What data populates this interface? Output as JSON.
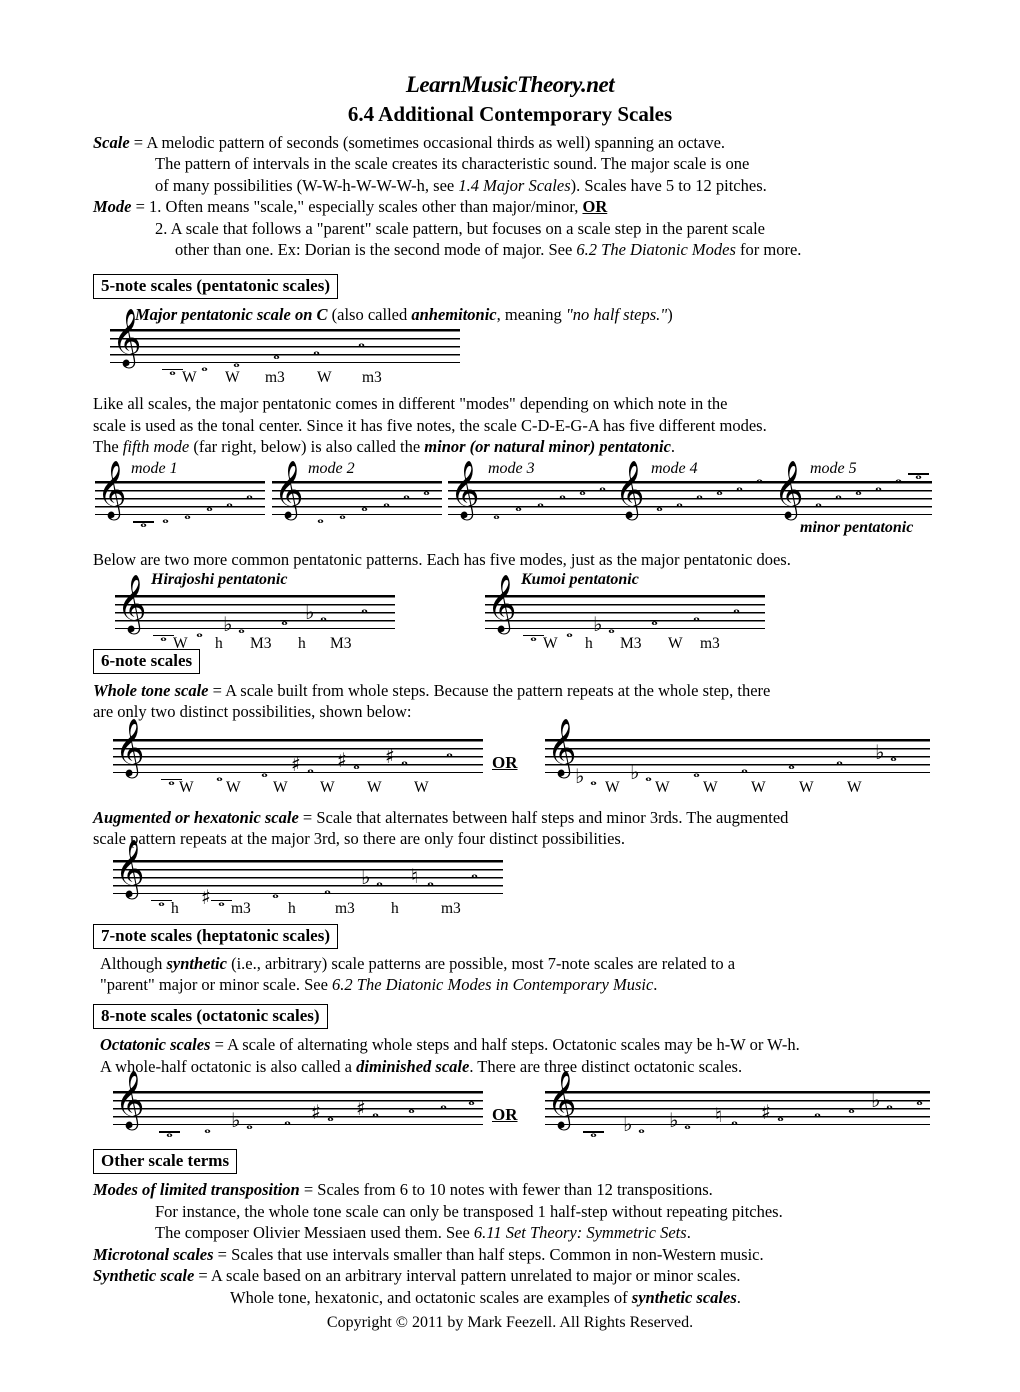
{
  "header": {
    "logo": "LearnMusicTheory.net",
    "title": "6.4 Additional Contemporary Scales"
  },
  "intro": {
    "scale_term": "Scale",
    "scale_def": " = A melodic pattern of seconds (sometimes occasional thirds as well) spanning an octave.",
    "scale_line2a": "The pattern of intervals in the scale creates its characteristic sound. The major scale is one",
    "scale_line3a": "of many possibilities (W-W-h-W-W-W-h, see ",
    "scale_line3_ital": "1.4 Major Scales",
    "scale_line3b": "). Scales have 5 to 12 pitches.",
    "mode_term": "Mode",
    "mode_def1a": " = 1. Often means \"scale,\" especially scales other than major/minor, ",
    "mode_or": "OR",
    "mode_def2": "2. A scale that follows a \"parent\" scale pattern, but focuses on a scale step in the parent scale",
    "mode_def3a": "other than one. Ex: Dorian is the second mode of major. See ",
    "mode_def3_ital": "6.2 The Diatonic Modes",
    "mode_def3b": " for more."
  },
  "sections": {
    "five_note": "5-note scales (pentatonic scales)",
    "six_note": "6-note scales",
    "seven_note": "7-note scales (heptatonic scales)",
    "eight_note": "8-note scales (octatonic scales)",
    "other_terms": "Other scale terms"
  },
  "pentatonic": {
    "caption_bold": "Major pentatonic scale on C",
    "caption_mid": " (also called ",
    "caption_bold2": "anhemitonic",
    "caption_mid2": ", meaning ",
    "caption_ital": "\"no half steps.\"",
    "caption_end": ")",
    "para_l1": "Like all scales, the major pentatonic comes in different \"modes\" depending on which note in the",
    "para_l2": "scale is used as the tonal center. Since it has five notes, the scale C-D-E-G-A has five different modes.",
    "para_l3a": "The ",
    "para_l3_ital": "fifth mode",
    "para_l3b": " (far right, below) is also called the ",
    "para_l3_bold": "minor (or natural minor) pentatonic",
    "para_l3c": ".",
    "modes_labels": [
      "mode 1",
      "mode 2",
      "mode 3",
      "mode 4",
      "mode 5"
    ],
    "minor_pent_label": "minor pentatonic",
    "below_text": "Below are two more common pentatonic patterns. Each has five modes, just as the major pentatonic does.",
    "hirajoshi_label": "Hirajoshi pentatonic",
    "kumoi_label": "Kumoi pentatonic"
  },
  "whole_tone": {
    "term": "Whole tone scale",
    "def_l1": " = A scale built from whole steps. Because the pattern repeats at the whole step, there",
    "def_l2": "are only two distinct possibilities, shown below:",
    "or_label": "OR"
  },
  "augmented": {
    "term": "Augmented or hexatonic scale",
    "def_l1": " = Scale that alternates between half steps and minor 3rds. The augmented",
    "def_l2": "scale pattern repeats at the major 3rd, so there are only four distinct possibilities."
  },
  "heptatonic": {
    "l1a": "Although ",
    "l1_bold": "synthetic",
    "l1b": " (i.e., arbitrary) scale patterns are possible, most 7-note scales are related to a",
    "l2a": "\"parent\" major or minor scale. See ",
    "l2_ital": "6.2 The Diatonic Modes in Contemporary Music",
    "l2b": "."
  },
  "octatonic": {
    "term": "Octatonic scales",
    "def_l1": " = A scale of alternating whole steps and half steps. Octatonic scales may be h-W or W-h.",
    "def_l2a": "A whole-half octatonic is also called a ",
    "def_l2_bold": "diminished scale",
    "def_l2b": ". There are three distinct octatonic scales.",
    "or_label": "OR"
  },
  "other_terms": {
    "mlt_term": "Modes of limited transposition",
    "mlt_def": " = Scales from 6 to 10 notes with fewer than 12 transpositions.",
    "mlt_l2": "For instance, the whole tone scale can only be transposed 1 half-step without repeating pitches.",
    "mlt_l3a": "The composer Olivier Messiaen used them. See ",
    "mlt_l3_ital": "6.11 Set Theory: Symmetric Sets",
    "mlt_l3b": ".",
    "micro_term": "Microtonal scales",
    "micro_def": " = Scales that use intervals smaller than half steps. Common in non-Western music.",
    "synth_term": "Synthetic scale",
    "synth_def": " = A scale based on an arbitrary interval pattern unrelated to major or minor scales.",
    "synth_l2a": "Whole tone, hexatonic, and octatonic scales are examples of ",
    "synth_l2_bold": "synthetic scales",
    "synth_l2b": "."
  },
  "copyright": "Copyright © 2011 by Mark Feezell. All Rights Reserved.",
  "chart_data": {
    "type": "table",
    "title": "Contemporary scale notation examples",
    "staves": [
      {
        "name": "major-pentatonic-on-C",
        "clef": "treble",
        "notes": [
          "C4",
          "D4",
          "E4",
          "G4",
          "A4",
          "C5"
        ],
        "accidentals": [
          "",
          "",
          "",
          "",
          "",
          ""
        ],
        "intervals": [
          "W",
          "W",
          "m3",
          "W",
          "m3"
        ]
      },
      {
        "name": "pentatonic-mode-1",
        "clef": "treble",
        "notes": [
          "C4",
          "D4",
          "E4",
          "G4",
          "A4",
          "C5"
        ],
        "intervals": []
      },
      {
        "name": "pentatonic-mode-2",
        "clef": "treble",
        "notes": [
          "D4",
          "E4",
          "G4",
          "A4",
          "C5",
          "D5"
        ],
        "intervals": []
      },
      {
        "name": "pentatonic-mode-3",
        "clef": "treble",
        "notes": [
          "E4",
          "G4",
          "A4",
          "C5",
          "D5",
          "E5"
        ],
        "intervals": []
      },
      {
        "name": "pentatonic-mode-4",
        "clef": "treble",
        "notes": [
          "G4",
          "A4",
          "C5",
          "D5",
          "E5",
          "G5"
        ],
        "intervals": []
      },
      {
        "name": "pentatonic-mode-5",
        "clef": "treble",
        "notes": [
          "A4",
          "C5",
          "D5",
          "E5",
          "G5",
          "A5"
        ],
        "intervals": []
      },
      {
        "name": "hirajoshi-pentatonic",
        "clef": "treble",
        "notes": [
          "C4",
          "D4",
          "Eb4",
          "G4",
          "Ab4",
          "C5"
        ],
        "accidentals": [
          "",
          "",
          "flat",
          "",
          "flat",
          ""
        ],
        "intervals": [
          "W",
          "h",
          "M3",
          "h",
          "M3"
        ]
      },
      {
        "name": "kumoi-pentatonic",
        "clef": "treble",
        "notes": [
          "C4",
          "D4",
          "Eb4",
          "G4",
          "A4",
          "C5"
        ],
        "accidentals": [
          "",
          "",
          "flat",
          "",
          "",
          ""
        ],
        "intervals": [
          "W",
          "h",
          "M3",
          "W",
          "m3"
        ]
      },
      {
        "name": "whole-tone-scale-1",
        "clef": "treble",
        "notes": [
          "C4",
          "D4",
          "E4",
          "F#4",
          "G#4",
          "A#4",
          "C5"
        ],
        "accidentals": [
          "",
          "",
          "",
          "sharp",
          "sharp",
          "sharp",
          ""
        ],
        "intervals": [
          "W",
          "W",
          "W",
          "W",
          "W",
          "W"
        ]
      },
      {
        "name": "whole-tone-scale-2",
        "clef": "treble",
        "notes": [
          "Db4",
          "Eb4",
          "F4",
          "G4",
          "A4",
          "B4",
          "Db5"
        ],
        "accidentals": [
          "flat",
          "flat",
          "",
          "",
          "",
          "",
          "flat"
        ],
        "intervals": [
          "W",
          "W",
          "W",
          "W",
          "W",
          "W"
        ]
      },
      {
        "name": "augmented-hexatonic-scale",
        "clef": "treble",
        "notes": [
          "C4",
          "C#4",
          "E4",
          "F4",
          "Ab4",
          "A4",
          "C5"
        ],
        "accidentals": [
          "",
          "sharp",
          "",
          "",
          "flat",
          "natural",
          ""
        ],
        "intervals": [
          "h",
          "m3",
          "h",
          "m3",
          "h",
          "m3"
        ]
      },
      {
        "name": "octatonic-whole-half",
        "clef": "treble",
        "notes": [
          "C4",
          "D4",
          "Eb4",
          "F4",
          "F#4",
          "G#4",
          "A4",
          "B4",
          "C5"
        ],
        "accidentals": [
          "",
          "",
          "flat",
          "",
          "sharp",
          "sharp",
          "",
          "",
          ""
        ],
        "intervals": []
      },
      {
        "name": "octatonic-half-whole",
        "clef": "treble",
        "notes": [
          "C4",
          "Db4",
          "Eb4",
          "E4",
          "F#4",
          "G4",
          "A4",
          "Bb4",
          "C5"
        ],
        "accidentals": [
          "",
          "flat",
          "flat",
          "natural",
          "sharp",
          "",
          "",
          "flat",
          ""
        ],
        "intervals": []
      }
    ]
  }
}
